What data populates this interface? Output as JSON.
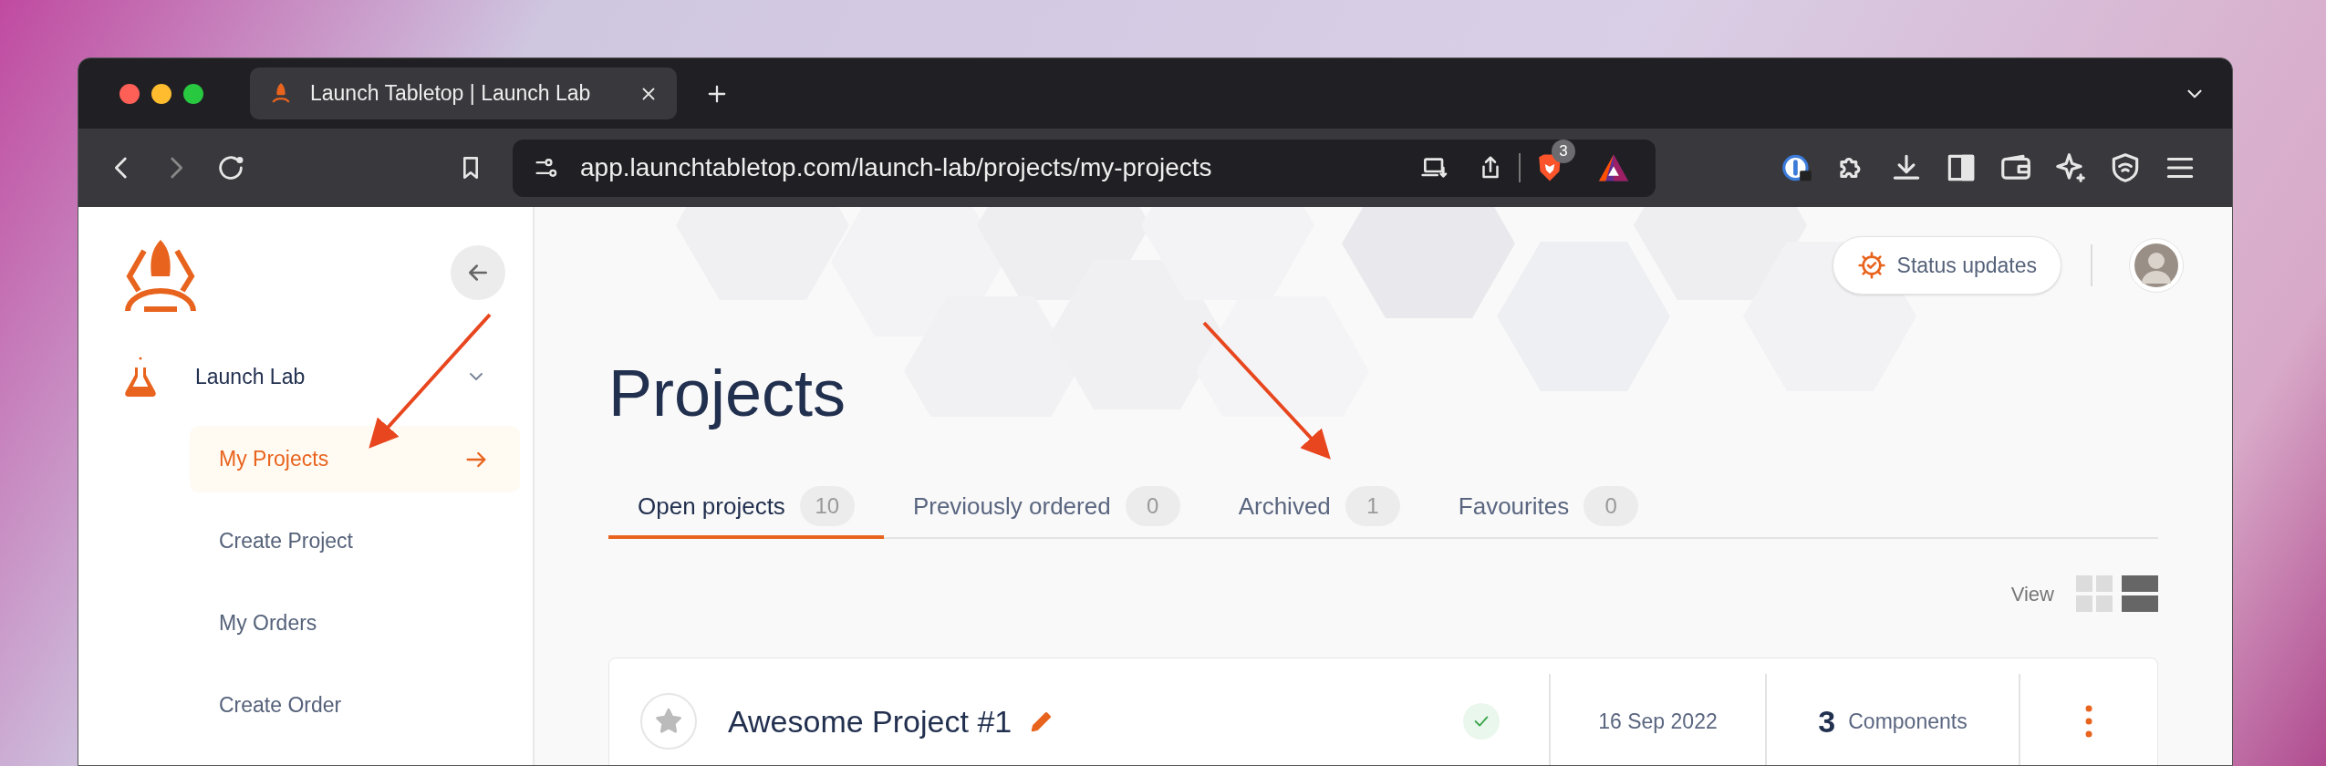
{
  "browser": {
    "tab_title": "Launch Tabletop | Launch Lab",
    "address": "app.launchtabletop.com/launch-lab/projects/my-projects",
    "shields_count": "3"
  },
  "sidebar": {
    "workspace": {
      "label": "Launch Lab",
      "expanded": true
    },
    "items": [
      {
        "label": "My Projects",
        "selected": true
      },
      {
        "label": "Create Project",
        "selected": false
      },
      {
        "label": "My Orders",
        "selected": false
      },
      {
        "label": "Create Order",
        "selected": false
      }
    ]
  },
  "header": {
    "status_button": "Status updates"
  },
  "page": {
    "title": "Projects",
    "tabs": [
      {
        "label": "Open projects",
        "count": "10",
        "selected": true
      },
      {
        "label": "Previously ordered",
        "count": "0",
        "selected": false
      },
      {
        "label": "Archived",
        "count": "1",
        "selected": false
      },
      {
        "label": "Favourites",
        "count": "0",
        "selected": false
      }
    ],
    "view": {
      "label": "View",
      "options": [
        {
          "kind": "grid",
          "selected": false
        },
        {
          "kind": "list",
          "selected": true
        }
      ]
    }
  },
  "projects": [
    {
      "name": "Awesome Project #1",
      "favourite": false,
      "verified": true,
      "date": "16 Sep 2022",
      "components_count": "3",
      "components_label": "Components"
    }
  ]
}
